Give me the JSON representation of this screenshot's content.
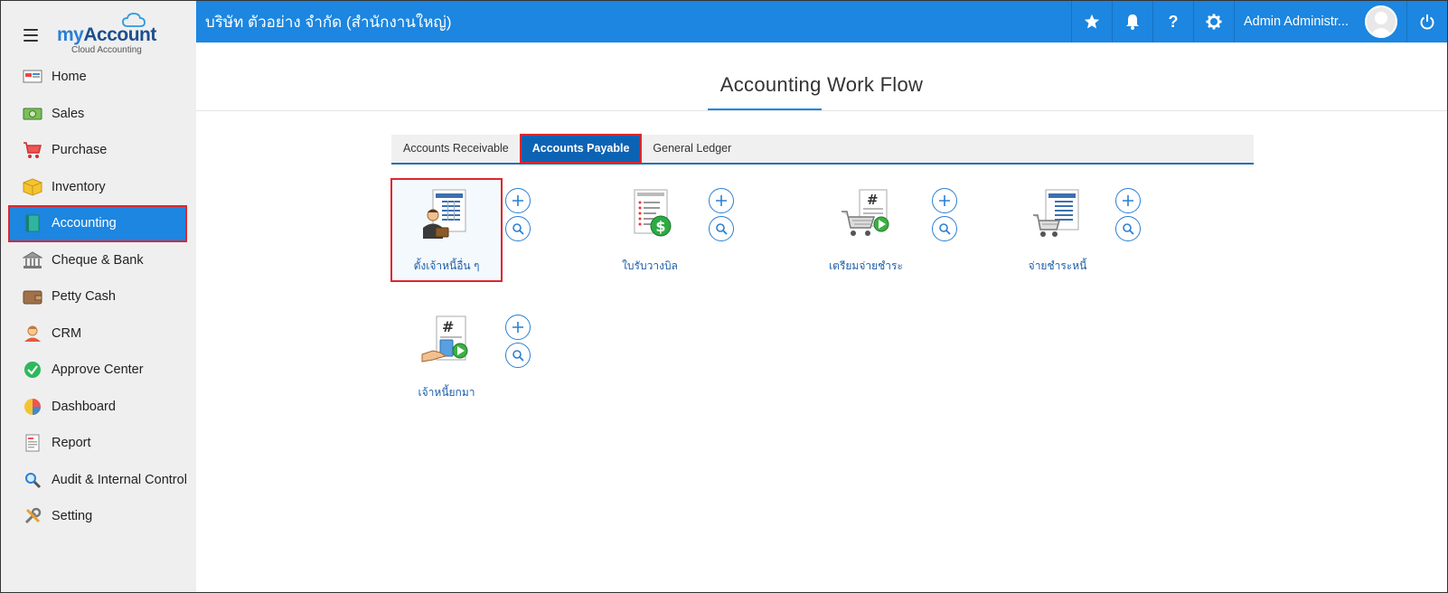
{
  "brand": {
    "logo_my": "my",
    "logo_account": "Account",
    "logo_sub": "Cloud Accounting"
  },
  "sidebar": {
    "items": [
      {
        "label": "Home",
        "icon": "home-icon"
      },
      {
        "label": "Sales",
        "icon": "money-icon"
      },
      {
        "label": "Purchase",
        "icon": "cart-icon"
      },
      {
        "label": "Inventory",
        "icon": "box-icon"
      },
      {
        "label": "Accounting",
        "icon": "ledger-book-icon",
        "active": true
      },
      {
        "label": "Cheque & Bank",
        "icon": "bank-icon"
      },
      {
        "label": "Petty Cash",
        "icon": "wallet-icon"
      },
      {
        "label": "CRM",
        "icon": "people-icon"
      },
      {
        "label": "Approve Center",
        "icon": "check-circle-icon"
      },
      {
        "label": "Dashboard",
        "icon": "pie-chart-icon"
      },
      {
        "label": "Report",
        "icon": "report-icon"
      },
      {
        "label": "Audit & Internal Control",
        "icon": "magnifier-icon"
      },
      {
        "label": "Setting",
        "icon": "tools-icon"
      }
    ]
  },
  "topbar": {
    "company": "บริษัท ตัวอย่าง จำกัด (สำนักงานใหญ่)",
    "help": "?",
    "user_name": "Admin Administr..."
  },
  "main": {
    "title": "Accounting Work Flow",
    "tabs": [
      {
        "label": "Accounts Receivable"
      },
      {
        "label": "Accounts Payable",
        "active": true
      },
      {
        "label": "General Ledger"
      }
    ],
    "tiles": [
      {
        "label": "ตั้งเจ้าหนี้อื่น ๆ",
        "selected": true
      },
      {
        "label": "ใบรับวางบิล"
      },
      {
        "label": "เตรียมจ่ายชำระ"
      },
      {
        "label": "จ่ายชำระหนี้"
      },
      {
        "label": "เจ้าหนี้ยกมา"
      }
    ],
    "hash_symbol": "#"
  },
  "colors": {
    "primary": "#1c86e0",
    "tab_active": "#0d63b3",
    "highlight": "#e0262b",
    "sidebar_bg": "#efeff0"
  }
}
